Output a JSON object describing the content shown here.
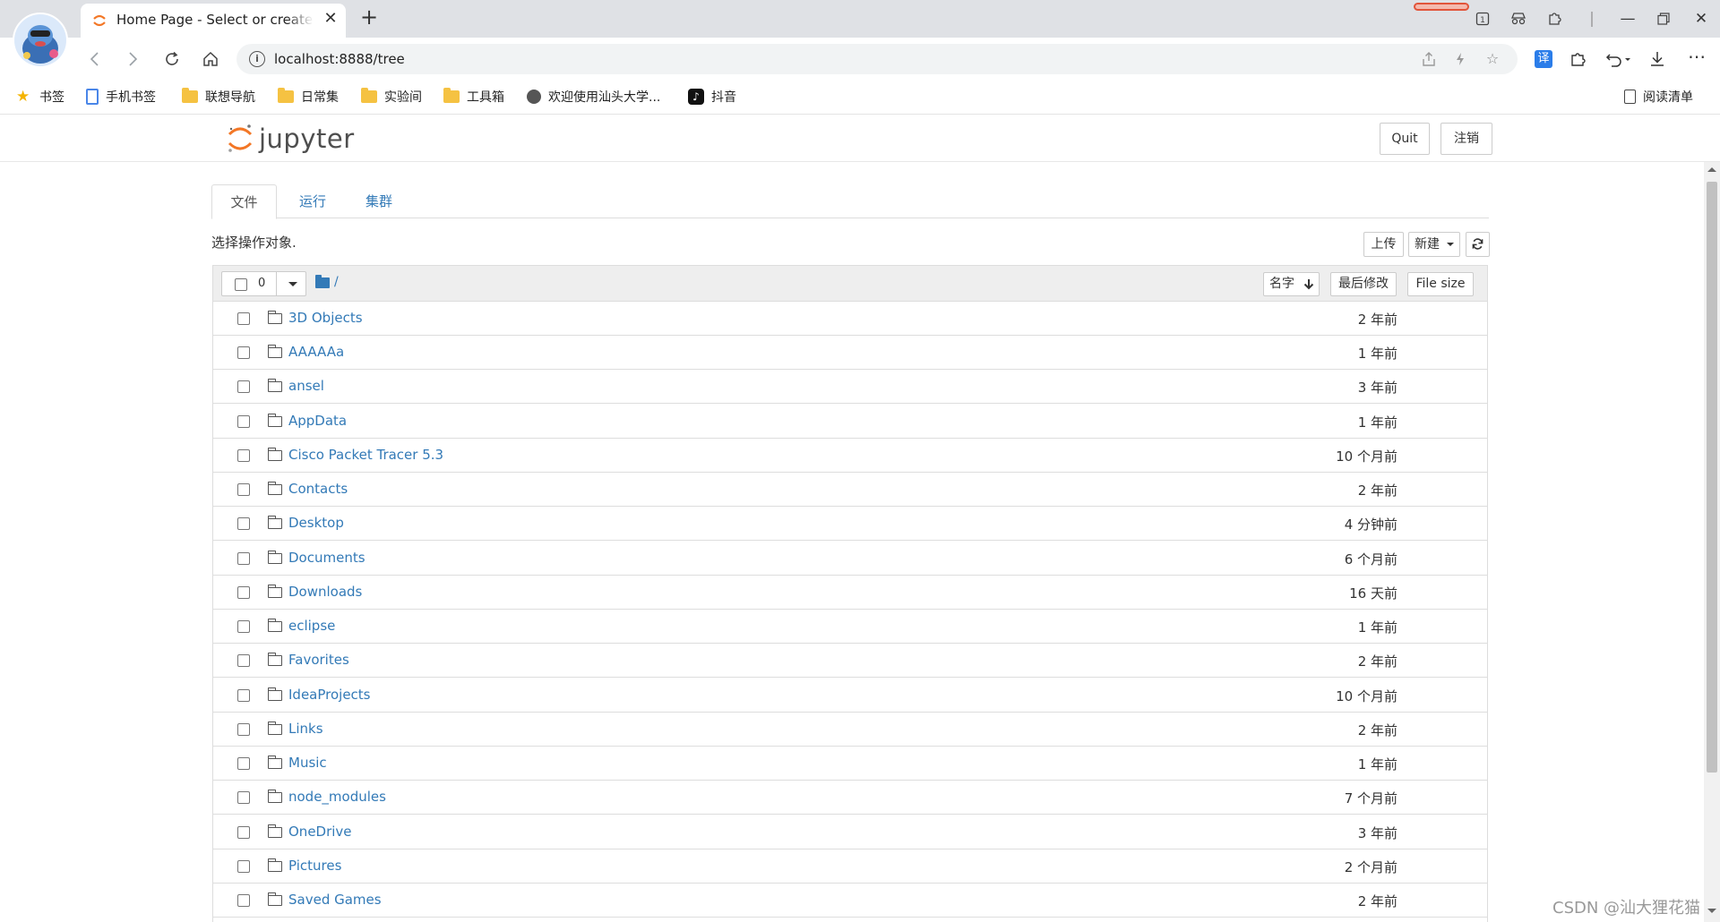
{
  "browser": {
    "tab_title": "Home Page - Select or create a notebook",
    "tab_close": "✕",
    "new_tab": "+",
    "url": "localhost:8888/tree",
    "bookmarks": [
      {
        "label": "书签",
        "icon": "star-icon"
      },
      {
        "label": "手机书签",
        "icon": "phone-bookmark-icon"
      },
      {
        "label": "联想导航",
        "icon": "folder-icon"
      },
      {
        "label": "日常集",
        "icon": "folder-icon"
      },
      {
        "label": "实验间",
        "icon": "folder-icon"
      },
      {
        "label": "工具箱",
        "icon": "folder-icon"
      },
      {
        "label": "欢迎使用汕头大学...",
        "icon": "site-icon"
      },
      {
        "label": "抖音",
        "icon": "douyin-icon"
      }
    ],
    "reading_list": "阅读清单",
    "translate_label": "译"
  },
  "jupyter": {
    "logo_text": "jupyter",
    "quit_label": "Quit",
    "logout_label": "注销",
    "tabs": [
      {
        "label": "文件",
        "active": true
      },
      {
        "label": "运行",
        "active": false
      },
      {
        "label": "集群",
        "active": false
      }
    ],
    "select_label": "选择操作对象.",
    "upload_label": "上传",
    "new_label": "新建",
    "list_header": {
      "selected_count": "0",
      "path": "/",
      "sort_name": "名字",
      "sort_modified": "最后修改",
      "sort_size": "File size"
    },
    "files": [
      {
        "name": "3D Objects",
        "modified": "2 年前"
      },
      {
        "name": "AAAAAa",
        "modified": "1 年前"
      },
      {
        "name": "ansel",
        "modified": "3 年前"
      },
      {
        "name": "AppData",
        "modified": "1 年前"
      },
      {
        "name": "Cisco Packet Tracer 5.3",
        "modified": "10 个月前"
      },
      {
        "name": "Contacts",
        "modified": "2 年前"
      },
      {
        "name": "Desktop",
        "modified": "4 分钟前"
      },
      {
        "name": "Documents",
        "modified": "6 个月前"
      },
      {
        "name": "Downloads",
        "modified": "16 天前"
      },
      {
        "name": "eclipse",
        "modified": "1 年前"
      },
      {
        "name": "Favorites",
        "modified": "2 年前"
      },
      {
        "name": "IdeaProjects",
        "modified": "10 个月前"
      },
      {
        "name": "Links",
        "modified": "2 年前"
      },
      {
        "name": "Music",
        "modified": "1 年前"
      },
      {
        "name": "node_modules",
        "modified": "7 个月前"
      },
      {
        "name": "OneDrive",
        "modified": "3 年前"
      },
      {
        "name": "Pictures",
        "modified": "2 个月前"
      },
      {
        "name": "Saved Games",
        "modified": "2 年前"
      }
    ]
  },
  "watermark": "CSDN @汕大狸花猫",
  "colors": {
    "link": "#337ab7",
    "jupyter_orange": "#f37726",
    "tabstrip": "#dfe1e5"
  }
}
